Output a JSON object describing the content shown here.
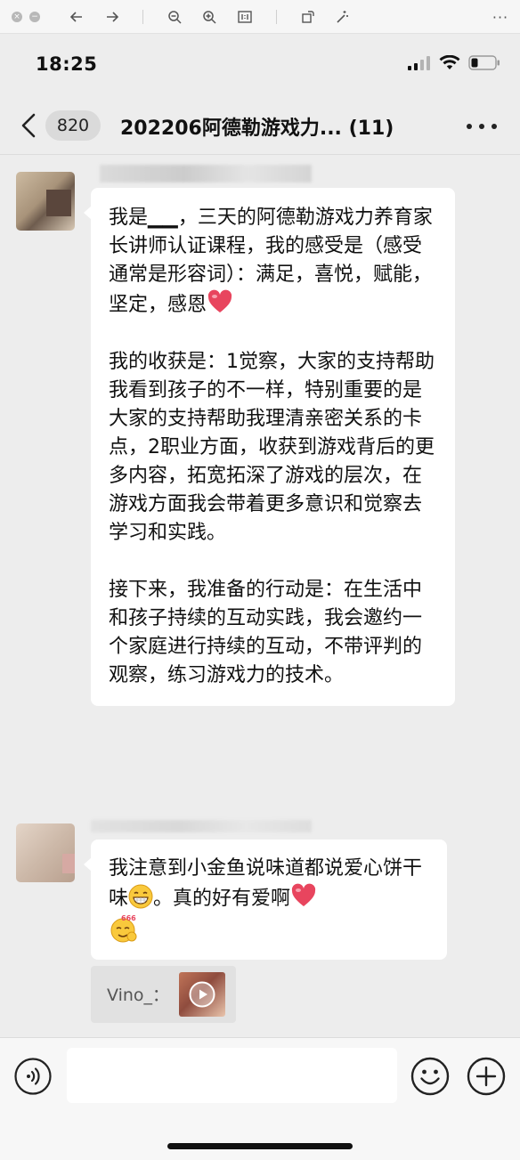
{
  "status_bar": {
    "time": "18:25"
  },
  "nav": {
    "unread_count": "820",
    "title": "202206阿德勒游戏力... (11)"
  },
  "messages": [
    {
      "paragraphs": [
        "我是▁▁，三天的阿德勒游戏力养育家长讲师认证课程，我的感受是（感受通常是形容词）：满足，喜悦，赋能，坚定，感恩",
        "我的收获是：1觉察，大家的支持帮助我看到孩子的不一样，特别重要的是大家的支持帮助我理清亲密关系的卡点，2职业方面，收获到游戏背后的更多内容，拓宽拓深了游戏的层次，在游戏方面我会带着更多意识和觉察去学习和实践。",
        "接下来，我准备的行动是：在生活中和孩子持续的互动实践，我会邀约一个家庭进行持续的互动，不带评判的观察，练习游戏力的技术。"
      ]
    },
    {
      "text_a": "我注意到小金鱼说味道都说爱心饼干味",
      "text_b": "。真的好有爱啊",
      "emoji_label": "666"
    }
  ],
  "quote": {
    "name": "Vino_："
  },
  "input": {
    "placeholder": ""
  },
  "colors": {
    "bubble": "#ffffff",
    "background": "#ededed",
    "heart": "#e8455e"
  }
}
